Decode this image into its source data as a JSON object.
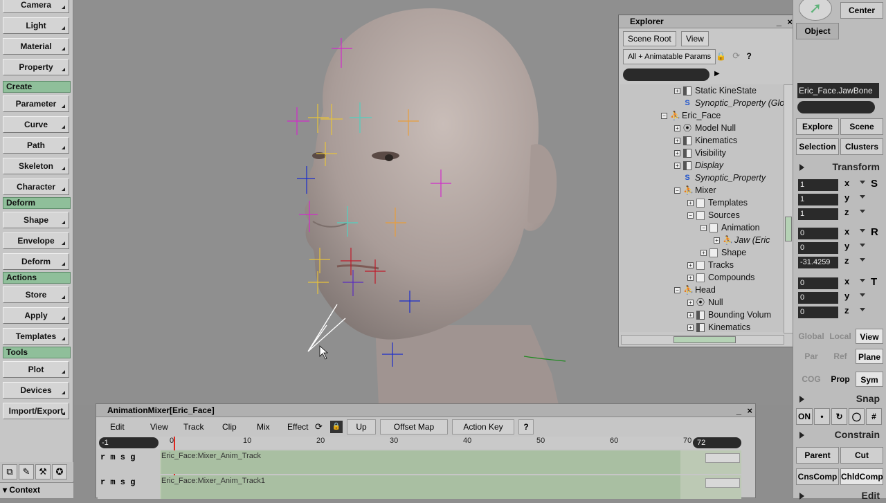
{
  "left_toolbar": {
    "top_buttons": [
      "Camera",
      "Light",
      "Material",
      "Property"
    ],
    "sections": [
      {
        "header": "Create",
        "buttons": [
          "Parameter",
          "Curve",
          "Path",
          "Skeleton",
          "Character"
        ]
      },
      {
        "header": "Deform",
        "buttons": [
          "Shape",
          "Envelope",
          "Deform"
        ]
      },
      {
        "header": "Actions",
        "buttons": [
          "Store",
          "Apply",
          "Templates"
        ]
      },
      {
        "header": "Tools",
        "buttons": [
          "Plot",
          "Devices",
          "Import/Export"
        ]
      }
    ],
    "context_label": "Context"
  },
  "explorer": {
    "title": "Explorer",
    "scene_root_button": "Scene Root",
    "view_button": "View",
    "filter_button": "All + Animatable Params",
    "tree": [
      {
        "label": "Static KineState",
        "icon": "prop",
        "level": 2,
        "expander": "plus"
      },
      {
        "label": "Synoptic_Property (Glo",
        "icon": "syn",
        "level": 2,
        "expander": "none",
        "italic": true
      },
      {
        "label": "Eric_Face",
        "icon": "fig",
        "level": 1,
        "expander": "minus"
      },
      {
        "label": "Model Null",
        "icon": "null",
        "level": 2,
        "expander": "plus"
      },
      {
        "label": "Kinematics",
        "icon": "prop",
        "level": 2,
        "expander": "plus"
      },
      {
        "label": "Visibility",
        "icon": "prop",
        "level": 2,
        "expander": "plus"
      },
      {
        "label": "Display",
        "icon": "prop",
        "level": 2,
        "expander": "plus",
        "italic": true
      },
      {
        "label": "Synoptic_Property",
        "icon": "syn",
        "level": 2,
        "expander": "none",
        "italic": true
      },
      {
        "label": "Mixer",
        "icon": "fig",
        "level": 2,
        "expander": "minus"
      },
      {
        "label": "Templates",
        "icon": "folder",
        "level": 3,
        "expander": "plus"
      },
      {
        "label": "Sources",
        "icon": "folder",
        "level": 3,
        "expander": "minus"
      },
      {
        "label": "Animation",
        "icon": "folder",
        "level": 4,
        "expander": "minus"
      },
      {
        "label": "Jaw (Eric",
        "icon": "fig",
        "level": 5,
        "expander": "plus",
        "italic": true
      },
      {
        "label": "Shape",
        "icon": "folder",
        "level": 4,
        "expander": "plus"
      },
      {
        "label": "Tracks",
        "icon": "folder",
        "level": 3,
        "expander": "plus"
      },
      {
        "label": "Compounds",
        "icon": "folder",
        "level": 3,
        "expander": "plus"
      },
      {
        "label": "Head",
        "icon": "fig",
        "level": 2,
        "expander": "minus"
      },
      {
        "label": "Null",
        "icon": "null",
        "level": 3,
        "expander": "plus"
      },
      {
        "label": "Bounding Volum",
        "icon": "prop",
        "level": 3,
        "expander": "plus"
      },
      {
        "label": "Kinematics",
        "icon": "prop",
        "level": 3,
        "expander": "plus"
      }
    ]
  },
  "right_panel": {
    "center_button": "Center",
    "object_button": "Object",
    "selected_name": "Eric_Face.JawBone",
    "buttons_row1": [
      "Explore",
      "Scene"
    ],
    "buttons_row2": [
      "Selection",
      "Clusters"
    ],
    "transform_header": "Transform",
    "scale": [
      {
        "value": "1",
        "axis": "x"
      },
      {
        "value": "1",
        "axis": "y"
      },
      {
        "value": "1",
        "axis": "z"
      }
    ],
    "rotate": [
      {
        "value": "0",
        "axis": "x"
      },
      {
        "value": "0",
        "axis": "y"
      },
      {
        "value": "-31.4259",
        "axis": "z"
      }
    ],
    "translate": [
      {
        "value": "0",
        "axis": "x"
      },
      {
        "value": "0",
        "axis": "y"
      },
      {
        "value": "0",
        "axis": "z"
      }
    ],
    "ref_row1": [
      "Global",
      "Local",
      "View"
    ],
    "ref_row2": [
      "Par",
      "Ref",
      "Plane"
    ],
    "ref_row3": [
      "COG",
      "Prop",
      "Sym"
    ],
    "snap_header": "Snap",
    "snap_on": "ON",
    "constrain_header": "Constrain",
    "constrain_row1": [
      "Parent",
      "Cut"
    ],
    "constrain_row2": [
      "CnsComp",
      "ChldComp"
    ],
    "edit_header": "Edit"
  },
  "mixer": {
    "title": "AnimationMixer[Eric_Face]",
    "menus": [
      "Edit",
      "View",
      "Track",
      "Clip",
      "Mix",
      "Effect"
    ],
    "up_button": "Up",
    "offset_button": "Offset Map",
    "action_key_button": "Action Key",
    "help_button": "?",
    "start_frame": "-1",
    "end_frame": "72",
    "ruler_ticks": [
      "0",
      "10",
      "20",
      "30",
      "40",
      "50",
      "60",
      "70"
    ],
    "track_controls": "r m s g",
    "tracks": [
      "Eric_Face:Mixer_Anim_Track",
      "Eric_Face:Mixer_Anim_Track1"
    ]
  },
  "colors": {
    "section_header": "#8fbf9a",
    "track": "#a9bfa2",
    "head": "#b9aea9"
  }
}
